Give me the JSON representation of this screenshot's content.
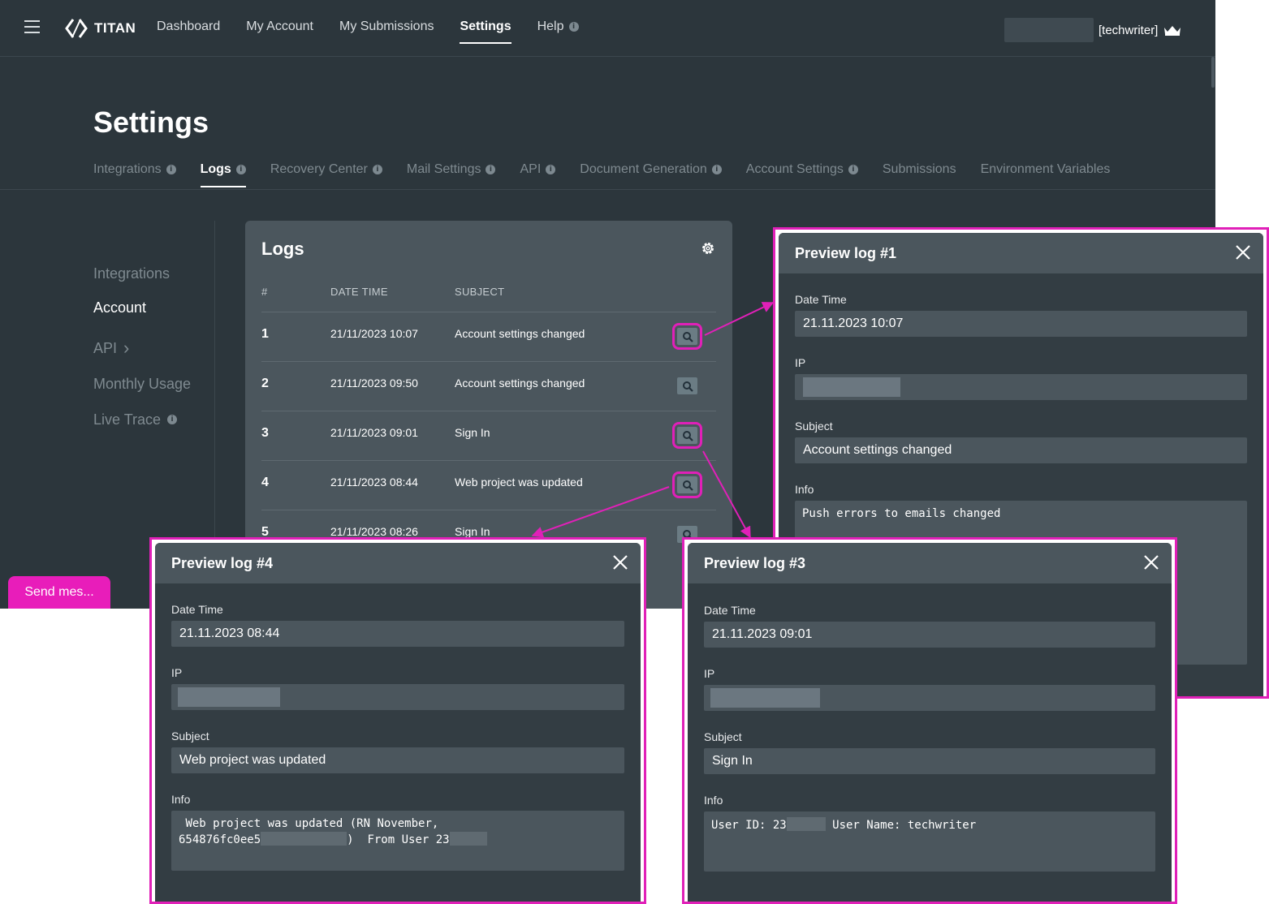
{
  "nav": {
    "brand": "TITAN",
    "links": [
      "Dashboard",
      "My Account",
      "My Submissions",
      "Settings",
      "Help"
    ],
    "help_info": "i",
    "user_label": "[techwriter]"
  },
  "settings": {
    "title": "Settings",
    "tabs": [
      {
        "label": "Integrations",
        "info": "i"
      },
      {
        "label": "Logs",
        "info": "i"
      },
      {
        "label": "Recovery Center",
        "info": "i"
      },
      {
        "label": "Mail Settings",
        "info": "i"
      },
      {
        "label": "API",
        "info": "i"
      },
      {
        "label": "Document Generation",
        "info": "i"
      },
      {
        "label": "Account Settings",
        "info": "i"
      },
      {
        "label": "Submissions",
        "info": ""
      },
      {
        "label": "Environment Variables",
        "info": ""
      }
    ]
  },
  "subnav": {
    "items": [
      "Integrations",
      "Account",
      "API",
      "Monthly Usage",
      "Live Trace"
    ],
    "api_chevron": "›",
    "live_trace_info": "i"
  },
  "logs": {
    "title": "Logs",
    "columns": {
      "num": "#",
      "datetime": "DATE TIME",
      "subject": "SUBJECT"
    },
    "rows": [
      {
        "num": "1",
        "datetime": "21/11/2023 10:07",
        "subject": "Account settings changed"
      },
      {
        "num": "2",
        "datetime": "21/11/2023 09:50",
        "subject": "Account settings changed"
      },
      {
        "num": "3",
        "datetime": "21/11/2023 09:01",
        "subject": "Sign In"
      },
      {
        "num": "4",
        "datetime": "21/11/2023 08:44",
        "subject": "Web project was updated"
      },
      {
        "num": "5",
        "datetime": "21/11/2023 08:26",
        "subject": "Sign In"
      }
    ]
  },
  "send_message": "Send mes...",
  "preview1": {
    "title": "Preview log #1",
    "datetime_label": "Date Time",
    "datetime": "21.11.2023 10:07",
    "ip_label": "IP",
    "subject_label": "Subject",
    "subject": "Account settings changed",
    "info_label": "Info",
    "info": "Push errors to emails changed"
  },
  "preview3": {
    "title": "Preview log #3",
    "datetime_label": "Date Time",
    "datetime": "21.11.2023 09:01",
    "ip_label": "IP",
    "subject_label": "Subject",
    "subject": "Sign In",
    "info_label": "Info",
    "info_a": "User ID: 23",
    "info_b": " User Name: techwriter"
  },
  "preview4": {
    "title": "Preview log #4",
    "datetime_label": "Date Time",
    "datetime": "21.11.2023 08:44",
    "ip_label": "IP",
    "subject_label": "Subject",
    "subject": "Web project was updated",
    "info_label": "Info",
    "info_a": " Web project was updated (RN November,",
    "info_b": "654876fc0ee5",
    "info_c": ")  From User 23"
  },
  "colors": {
    "highlight": "#e020b8",
    "send_button": "#e81dba",
    "background": "#2c363c",
    "card": "#4b565d"
  }
}
